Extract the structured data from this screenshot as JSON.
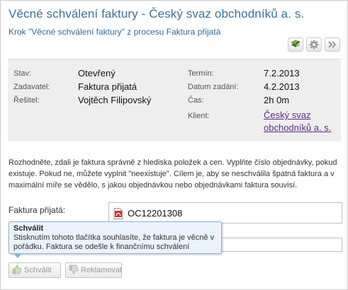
{
  "header": {
    "title": "Věcné schválení faktury - Český svaz obchodníků a. s.",
    "subtitle": "Krok \"Věcné schválení faktury\" z procesu Faktura přijatá"
  },
  "toolbar": {
    "icons": [
      "approve-check-icon",
      "gear-icon",
      "double-chevron-right-icon"
    ]
  },
  "info": {
    "stav_label": "Stav:",
    "stav_value": "Otevřený",
    "zadavatel_label": "Zadavatel:",
    "zadavatel_value": "Faktura přijatá",
    "resitel_label": "Řešitel:",
    "resitel_value": "Vojtěch Filipovský",
    "termin_label": "Termín:",
    "termin_value": "7.2.2013",
    "datum_label": "Datum zadání:",
    "datum_value": "4.2.2013",
    "cas_label": "Čas:",
    "cas_value": "2h 0m",
    "klient_label": "Klient:",
    "klient_line1": "Český svaz",
    "klient_line2": "obchodníků a. s."
  },
  "instructions": "Rozhodněte, zdali je faktura správně z hlediska položek a cen. Vyplňte číslo objednávky, pokud existuje. Pokud ne, můžete vyplnit \"neexistuje\". Cílem je, aby se neschválila špatná faktura a v maximální míře se vědělo, s jakou objednávkou nebo objednávkami faktura souvisí.",
  "form": {
    "faktura_label": "Faktura přijatá:",
    "faktura_file": "OC12201308",
    "objednavka_value": ""
  },
  "tooltip": {
    "title": "Schválit",
    "text": "Stisknutím tohoto tlačítka souhlasíte, že faktura je věcně v pořádku. Faktura se odešle k finančnímu schválení"
  },
  "buttons": {
    "approve_label": "Schválit",
    "reject_label": "Reklamovat"
  }
}
